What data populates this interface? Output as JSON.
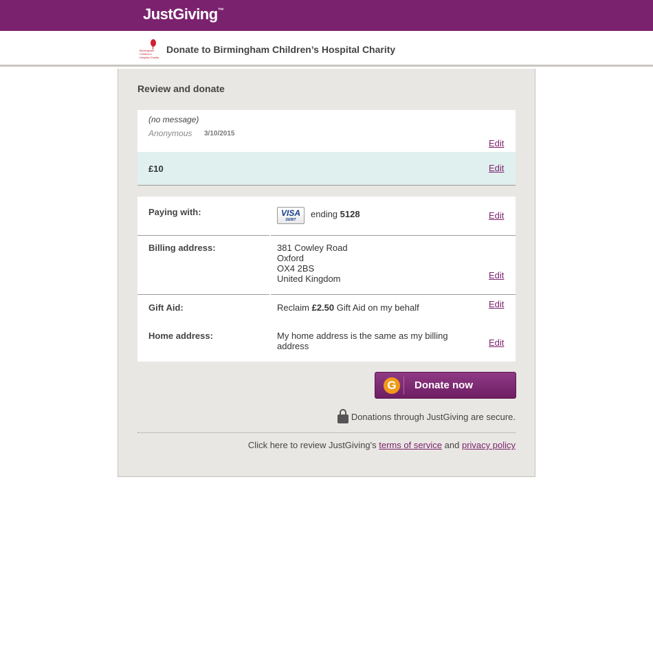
{
  "header": {
    "logo_text": "JustGiving",
    "logo_tm": "™"
  },
  "charity": {
    "logo_text": "Birmingham Children's Hospital Charity",
    "title": "Donate to Birmingham Children’s Hospital Charity"
  },
  "review": {
    "title": "Review and donate",
    "message": "(no message)",
    "donor_name": "Anonymous",
    "date": "3/10/2015",
    "message_edit": "Edit",
    "amount": "£10",
    "amount_edit": "Edit"
  },
  "payment": {
    "paying_label": "Paying with:",
    "card_brand": "VISA",
    "card_type": "DEBIT",
    "ending_prefix": "ending",
    "ending_digits": "5128",
    "paying_edit": "Edit",
    "billing_label": "Billing address:",
    "billing_lines": [
      "381 Cowley Road",
      "Oxford",
      "OX4 2BS",
      "United Kingdom"
    ],
    "billing_edit": "Edit",
    "giftaid_label": "Gift Aid:",
    "giftaid_prefix": "Reclaim",
    "giftaid_amount": "£2.50",
    "giftaid_suffix": "Gift Aid on my behalf",
    "giftaid_edit": "Edit",
    "home_label": "Home address:",
    "home_value": "My home address is the same as my billing address",
    "home_edit": "Edit"
  },
  "actions": {
    "donate_label": "Donate now",
    "donate_icon": "G",
    "secure_text": "Donations through JustGiving are secure.",
    "terms_prefix": "Click here to review JustGiving's",
    "terms_link": "terms of service",
    "terms_and": "and",
    "privacy_link": "privacy policy"
  },
  "colors": {
    "brand_purple": "#7b226e",
    "panel_bg": "#e9e7e3",
    "amount_bg": "#dff0ef",
    "g_orange": "#f09a1a"
  }
}
